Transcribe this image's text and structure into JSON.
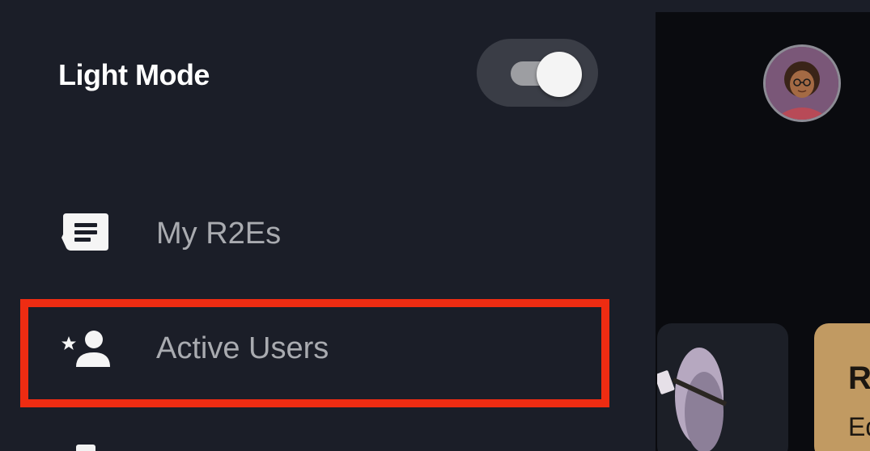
{
  "drawer": {
    "mode_label": "Light Mode",
    "toggle_on": true,
    "items": [
      {
        "label": "My R2Es",
        "icon": "feedback-message-icon"
      },
      {
        "label": "Active Users",
        "icon": "person-star-icon"
      }
    ]
  },
  "background": {
    "card_title": "R",
    "card_subtitle": "Ed"
  },
  "colors": {
    "drawer_bg": "#1b1e28",
    "highlight": "#ee2c12",
    "label_muted": "#a9abb0",
    "card_gold": "#c19a62"
  }
}
